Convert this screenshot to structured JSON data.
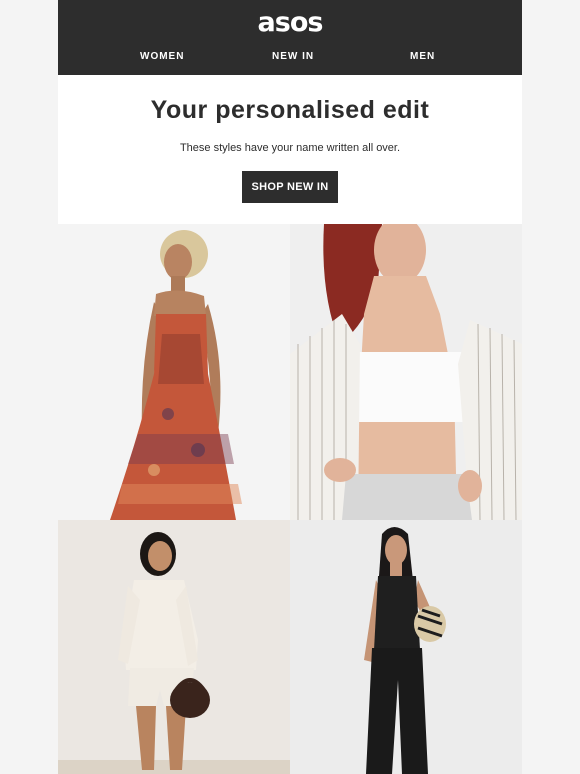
{
  "header": {
    "logo": "asos",
    "nav": {
      "women": "WOMEN",
      "new_in": "NEW IN",
      "men": "MEN"
    }
  },
  "hero": {
    "title": "Your personalised edit",
    "subtitle": "These styles have your name written all over.",
    "cta_label": "SHOP NEW IN"
  },
  "products": [
    {
      "name": "floral-print-maxi-dress"
    },
    {
      "name": "white-crop-top-striped-shirt"
    },
    {
      "name": "cream-cardigan-shorts-set"
    },
    {
      "name": "black-waistcoat-trousers-set"
    }
  ],
  "colors": {
    "header_bg": "#2d2d2d",
    "cta_bg": "#2d2d2d",
    "text": "#2d2d2d",
    "page_bg": "#f4f4f4"
  }
}
